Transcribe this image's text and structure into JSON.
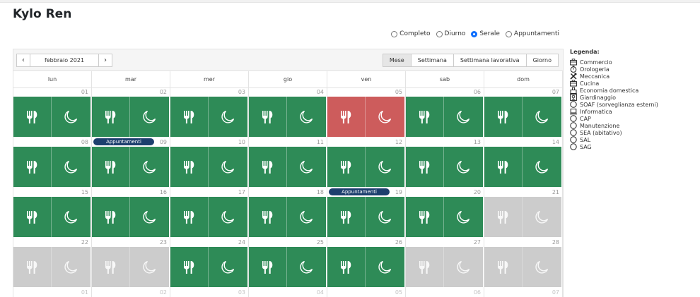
{
  "page": {
    "title": "Kylo Ren"
  },
  "filters": [
    {
      "label": "Completo",
      "checked": false
    },
    {
      "label": "Diurno",
      "checked": false
    },
    {
      "label": "Serale",
      "checked": true
    },
    {
      "label": "Appuntamenti",
      "checked": false
    }
  ],
  "calendar": {
    "month_label": "febbraio 2021",
    "prev_glyph": "‹",
    "next_glyph": "›",
    "views": [
      {
        "label": "Mese",
        "active": true
      },
      {
        "label": "Settimana",
        "active": false
      },
      {
        "label": "Settimana lavorativa",
        "active": false
      },
      {
        "label": "Giorno",
        "active": false
      }
    ],
    "weekdays": [
      "lun",
      "mar",
      "mer",
      "gio",
      "ven",
      "sab",
      "dom"
    ],
    "weeks": [
      [
        {
          "day": "01",
          "status": "green"
        },
        {
          "day": "02",
          "status": "green"
        },
        {
          "day": "03",
          "status": "green"
        },
        {
          "day": "04",
          "status": "green"
        },
        {
          "day": "05",
          "status": "red"
        },
        {
          "day": "06",
          "status": "green"
        },
        {
          "day": "07",
          "status": "green"
        }
      ],
      [
        {
          "day": "08",
          "status": "green"
        },
        {
          "day": "09",
          "status": "green",
          "event": "Appuntamenti"
        },
        {
          "day": "10",
          "status": "green"
        },
        {
          "day": "11",
          "status": "green"
        },
        {
          "day": "12",
          "status": "green"
        },
        {
          "day": "13",
          "status": "green"
        },
        {
          "day": "14",
          "status": "green"
        }
      ],
      [
        {
          "day": "15",
          "status": "green"
        },
        {
          "day": "16",
          "status": "green"
        },
        {
          "day": "17",
          "status": "green"
        },
        {
          "day": "18",
          "status": "green"
        },
        {
          "day": "19",
          "status": "green",
          "event": "Appuntamenti"
        },
        {
          "day": "20",
          "status": "green"
        },
        {
          "day": "21",
          "status": "gray"
        }
      ],
      [
        {
          "day": "22",
          "status": "gray"
        },
        {
          "day": "23",
          "status": "gray"
        },
        {
          "day": "24",
          "status": "green"
        },
        {
          "day": "25",
          "status": "green"
        },
        {
          "day": "26",
          "status": "green"
        },
        {
          "day": "27",
          "status": "gray"
        },
        {
          "day": "28",
          "status": "gray"
        }
      ]
    ],
    "next_week_days": [
      "01",
      "02",
      "03",
      "04",
      "05",
      "06",
      "07"
    ],
    "tile_icons": {
      "left": "fork-knife-icon",
      "right": "moon-icon"
    },
    "colors": {
      "green": "#2e8b57",
      "red": "#cd5c5c",
      "gray": "#cccccc",
      "event": "#1d3f6e"
    }
  },
  "legend": {
    "title": "Legenda:",
    "items": [
      {
        "label": "Commercio",
        "icon": "briefcase-icon"
      },
      {
        "label": "Orologeria",
        "icon": "stopwatch-icon"
      },
      {
        "label": "Meccanica",
        "icon": "tools-icon"
      },
      {
        "label": "Cucina",
        "icon": "briefcase-icon"
      },
      {
        "label": "Economia domestica",
        "icon": "house-icon"
      },
      {
        "label": "Giardinaggio",
        "icon": "plant-icon"
      },
      {
        "label": "SOAF (sorveglianza esterni)",
        "icon": "circle-icon"
      },
      {
        "label": "Informatica",
        "icon": "laptop-icon"
      },
      {
        "label": "CAP",
        "icon": "circle-icon"
      },
      {
        "label": "Manutenzione",
        "icon": "circle-icon"
      },
      {
        "label": "SEA (abitativo)",
        "icon": "circle-icon"
      },
      {
        "label": "SAL",
        "icon": "circle-icon"
      },
      {
        "label": "SAG",
        "icon": "circle-icon"
      }
    ]
  }
}
